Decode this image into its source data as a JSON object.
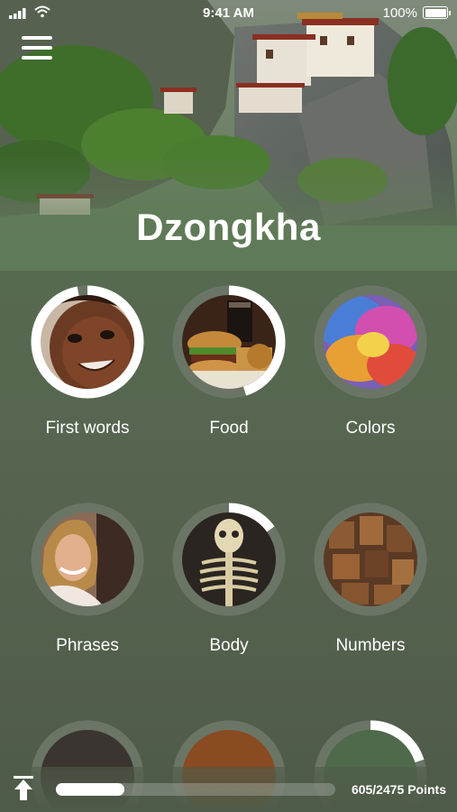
{
  "status_bar": {
    "time": "9:41 AM",
    "battery": "100%"
  },
  "header": {
    "title": "Dzongkha"
  },
  "categories": [
    {
      "label": "First words",
      "progress": 0.97,
      "photo": "baby-face"
    },
    {
      "label": "Food",
      "progress": 0.45,
      "photo": "burger-and-fries"
    },
    {
      "label": "Colors",
      "progress": 0.0,
      "photo": "color-powder"
    },
    {
      "label": "Phrases",
      "progress": 0.0,
      "photo": "smiling-woman"
    },
    {
      "label": "Body",
      "progress": 0.15,
      "photo": "skeleton"
    },
    {
      "label": "Numbers",
      "progress": 0.0,
      "photo": "wooden-numbers"
    },
    {
      "label": "",
      "progress": 0.0,
      "photo": "partial"
    },
    {
      "label": "",
      "progress": 0.0,
      "photo": "partial"
    },
    {
      "label": "",
      "progress": 0.2,
      "photo": "partial"
    }
  ],
  "footer": {
    "points": "605/2475 Points",
    "points_earned": 605,
    "points_total": 2475
  },
  "colors": {
    "ring_track": "#6b7566",
    "ring_fill": "#ffffff",
    "background": "#566b51"
  }
}
